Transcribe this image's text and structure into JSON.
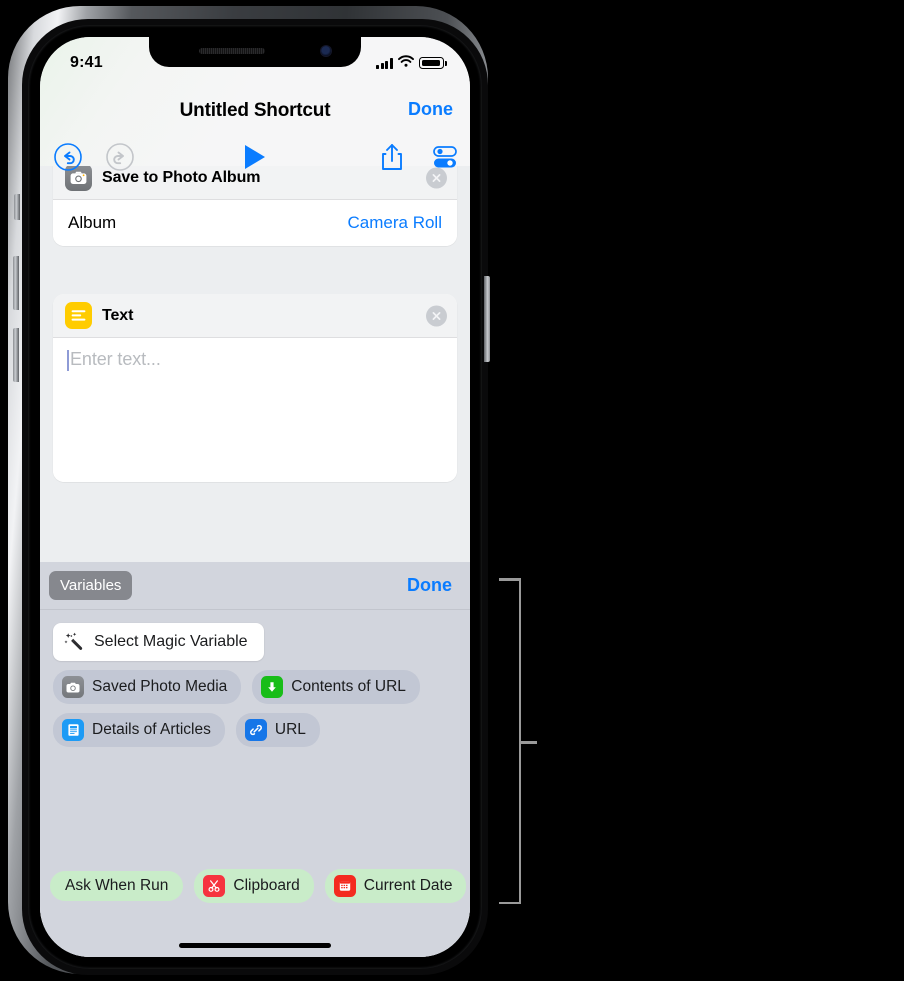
{
  "status_bar": {
    "time": "9:41",
    "signal_icon": "cellular-bars-icon",
    "wifi_icon": "wifi-icon",
    "battery_icon": "battery-icon"
  },
  "nav": {
    "title": "Untitled Shortcut",
    "done_label": "Done",
    "toolbar": {
      "undo": "undo-icon",
      "redo": "redo-icon",
      "play": "play-icon",
      "share": "share-icon",
      "settings": "settings-sliders-icon"
    }
  },
  "actions": [
    {
      "icon": "camera-icon",
      "title": "Save to Photo Album",
      "remove": "close-icon",
      "param_label": "Album",
      "param_value": "Camera Roll"
    },
    {
      "icon": "text-lines-icon",
      "title": "Text",
      "remove": "close-icon",
      "placeholder": "Enter text..."
    }
  ],
  "variables_panel": {
    "tab_label": "Variables",
    "done_label": "Done",
    "magic_variable": {
      "label": "Select Magic Variable",
      "icon": "magic-wand-icon"
    },
    "rows": [
      [
        {
          "label": "Saved Photo Media",
          "icon": "camera-icon",
          "style": "blue-soft"
        },
        {
          "label": "Contents of URL",
          "icon": "download-arrow-icon",
          "style": "blue-soft"
        }
      ],
      [
        {
          "label": "Details of Articles",
          "icon": "document-icon",
          "style": "blue-soft"
        },
        {
          "label": "URL",
          "icon": "link-icon",
          "style": "blue-soft"
        }
      ]
    ],
    "bottom_chips": [
      {
        "label": "Ask When Run",
        "icon": "none",
        "style": "green-soft"
      },
      {
        "label": "Clipboard",
        "icon": "scissors-icon",
        "style": "green-soft"
      },
      {
        "label": "Current Date",
        "icon": "calendar-icon",
        "style": "green-soft"
      }
    ]
  },
  "home_indicator": "home-indicator",
  "callout": {
    "bracket": "annotation-bracket"
  },
  "colors": {
    "accent_blue": "#0a7cff",
    "panel_bg": "#d2d5dd",
    "content_bg": "#eceef0",
    "chip_blue": "#c2c7d4",
    "chip_green": "#c9ecc9",
    "yellow": "#ffcc00",
    "green": "#18bd18",
    "red": "#f6333f"
  }
}
